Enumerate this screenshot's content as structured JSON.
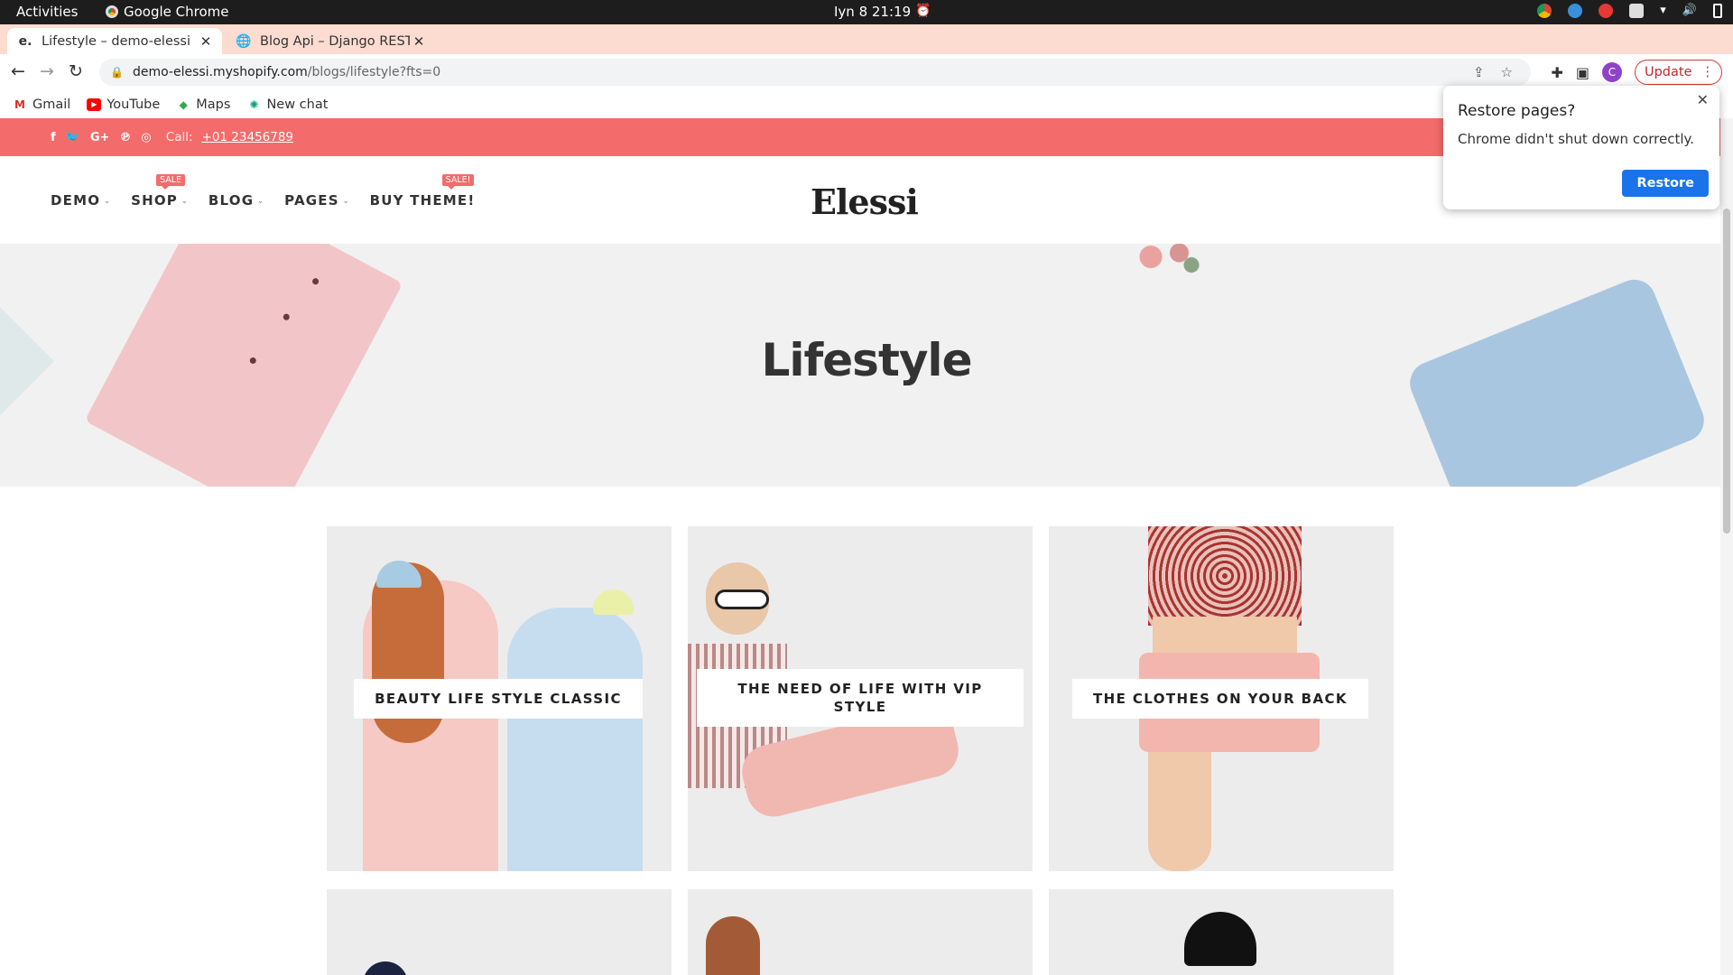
{
  "system": {
    "activities": "Activities",
    "app_name": "Google Chrome",
    "clock": "Iyn 8  21:19"
  },
  "tabs": [
    {
      "label": "Lifestyle – demo-elessi",
      "favicon": "e."
    },
    {
      "label": "Blog Api – Django REST fr",
      "favicon": "globe-icon"
    }
  ],
  "toolbar": {
    "url_host": "demo-elessi.myshopify.com",
    "url_path": "/blogs/lifestyle?fts=0",
    "update_label": "Update",
    "avatar_letter": "C"
  },
  "bookmarks": [
    {
      "label": "Gmail",
      "icon": "gmail-icon",
      "color": "#d93025"
    },
    {
      "label": "YouTube",
      "icon": "youtube-icon",
      "color": "#ff0000"
    },
    {
      "label": "Maps",
      "icon": "maps-icon",
      "color": "#34a853"
    },
    {
      "label": "New chat",
      "icon": "chatgpt-icon",
      "color": "#10a37f"
    }
  ],
  "site": {
    "call_label": "Call:",
    "phone": "+01 23456789",
    "menu": [
      {
        "label": "DEMO",
        "badge": ""
      },
      {
        "label": "SHOP",
        "badge": "SALE"
      },
      {
        "label": "BLOG",
        "badge": ""
      },
      {
        "label": "PAGES",
        "badge": ""
      },
      {
        "label": "BUY THEME!",
        "badge": "SALE!"
      }
    ],
    "logo": "Elessi",
    "hero_title": "Lifestyle",
    "accent_color": "#f46b6b",
    "posts": [
      {
        "title": "BEAUTY LIFE STYLE CLASSIC"
      },
      {
        "title": "THE NEED OF LIFE WITH VIP STYLE"
      },
      {
        "title": "THE CLOTHES ON YOUR BACK"
      }
    ]
  },
  "restore_popup": {
    "title": "Restore pages?",
    "message": "Chrome didn't shut down correctly.",
    "button": "Restore"
  }
}
